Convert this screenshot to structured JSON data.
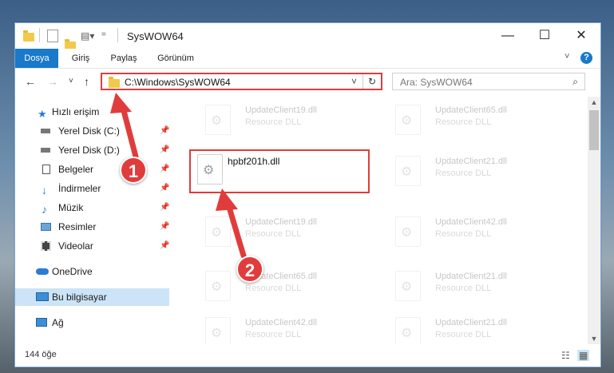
{
  "window": {
    "title": "SysWOW64",
    "minimize": "—",
    "maximize": "☐",
    "close": "✕"
  },
  "ribbon": {
    "tabs": [
      "Dosya",
      "Giriş",
      "Paylaş",
      "Görünüm"
    ],
    "active": "Dosya",
    "collapse_icon": "˅",
    "help_icon": "?"
  },
  "nav": {
    "back": "←",
    "forward": "→",
    "recent": "˅",
    "up": "↑",
    "address": "C:\\Windows\\SysWOW64",
    "address_dropdown": "˅",
    "refresh": "↻",
    "search_placeholder": "Ara: SysWOW64",
    "search_icon": "⌕"
  },
  "sidebar": {
    "items": [
      {
        "label": "Hızlı erişim",
        "icon": "star-icon",
        "pinned": false
      },
      {
        "label": "Yerel Disk (C:)",
        "icon": "drive-icon",
        "pinned": true
      },
      {
        "label": "Yerel Disk (D:)",
        "icon": "drive-icon",
        "pinned": true
      },
      {
        "label": "Belgeler",
        "icon": "documents-icon",
        "pinned": true
      },
      {
        "label": "İndirmeler",
        "icon": "download-icon",
        "pinned": true
      },
      {
        "label": "Müzik",
        "icon": "music-icon",
        "pinned": true
      },
      {
        "label": "Resimler",
        "icon": "pictures-icon",
        "pinned": true
      },
      {
        "label": "Videolar",
        "icon": "video-icon",
        "pinned": true
      },
      {
        "label": "OneDrive",
        "icon": "cloud-icon",
        "pinned": false
      },
      {
        "label": "Bu bilgisayar",
        "icon": "computer-icon",
        "pinned": false
      },
      {
        "label": "Ağ",
        "icon": "network-icon",
        "pinned": false
      }
    ],
    "pin_glyph": "📌"
  },
  "files": {
    "highlighted": {
      "name": "hpbf201h.dll"
    },
    "left_column": [
      {
        "name": "UpdateClient19.dll",
        "type": "Resource DLL"
      },
      {
        "name": "UpdateClient19.dll",
        "type": "Resource DLL"
      },
      {
        "name": "UpdateClient65.dll",
        "type": "Resource DLL"
      },
      {
        "name": "UpdateClient42.dll",
        "type": "Resource DLL"
      }
    ],
    "right_column": [
      {
        "name": "UpdateClient65.dll",
        "type": "Resource DLL"
      },
      {
        "name": "UpdateClient21.dll",
        "type": "Resource DLL"
      },
      {
        "name": "UpdateClient42.dll",
        "type": "Resource DLL"
      },
      {
        "name": "UpdateClient21.dll",
        "type": "Resource DLL"
      },
      {
        "name": "UpdateClient21.dll",
        "type": "Resource DLL"
      }
    ]
  },
  "status": {
    "count": "144 öğe"
  },
  "annotations": {
    "step1": "1",
    "step2": "2",
    "color": "#e03c3c"
  },
  "colors": {
    "accent": "#1979ca",
    "selected": "#cce4f7",
    "highlight": "#e03c3c"
  }
}
